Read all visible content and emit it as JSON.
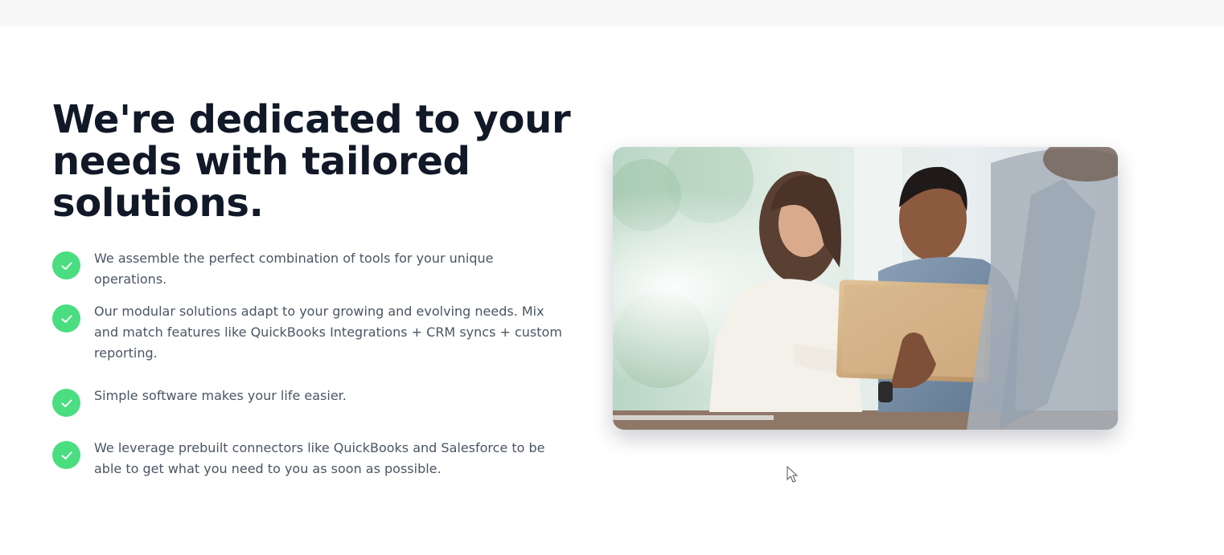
{
  "headline": "We're dedicated to your needs with tailored solutions.",
  "features": [
    {
      "icon": "check-circle-icon",
      "text": "We assemble the perfect combination of tools for your unique operations."
    },
    {
      "icon": "check-circle-icon",
      "text": "Our modular solutions adapt to your growing and evolving needs. Mix and match features like QuickBooks Integrations + CRM syncs + custom reporting."
    },
    {
      "icon": "check-circle-icon",
      "text": "Simple software makes your life easier."
    },
    {
      "icon": "check-circle-icon",
      "text": "We leverage prebuilt connectors like QuickBooks and Salesforce to be able to get what you need to you as soon as possible."
    }
  ],
  "photo": {
    "icon": "team-laptop-photo"
  },
  "colors": {
    "accent_green": "#4ade80",
    "heading": "#111827",
    "body_text": "#4b5563"
  }
}
